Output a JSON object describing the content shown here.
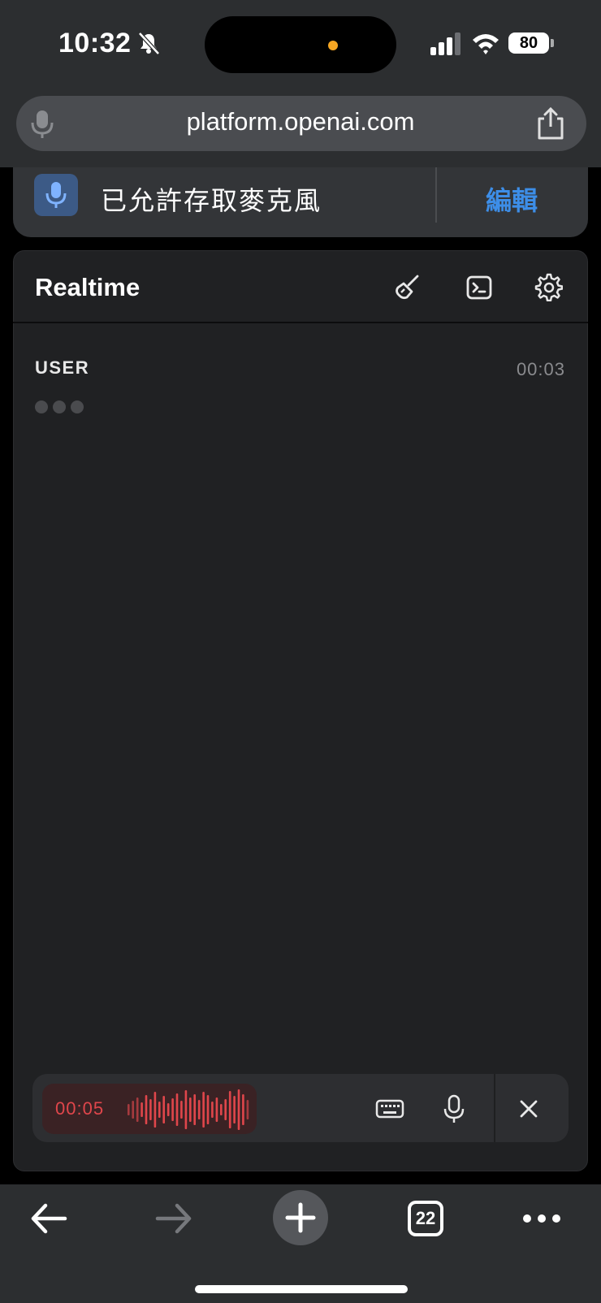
{
  "status_bar": {
    "time": "10:32",
    "battery": "80",
    "icons": [
      "bell-slash-icon",
      "cellular-signal-icon",
      "wifi-icon",
      "battery-icon"
    ]
  },
  "browser": {
    "url": "platform.openai.com",
    "permission_text": "已允許存取麥克風",
    "permission_action": "編輯",
    "tab_count": "22"
  },
  "app": {
    "title": "Realtime",
    "header_icons": [
      "broom-icon",
      "terminal-icon",
      "gear-icon"
    ],
    "messages": [
      {
        "role": "USER",
        "timestamp": "00:03"
      }
    ],
    "recording": {
      "elapsed": "00:05",
      "controls": [
        "keyboard-icon",
        "microphone-icon",
        "close-icon"
      ]
    }
  },
  "colors": {
    "accent_blue": "#3d8ee8",
    "recording_red": "#e0464b",
    "panel_bg": "#202123",
    "chrome_bg": "#2c2e30"
  }
}
